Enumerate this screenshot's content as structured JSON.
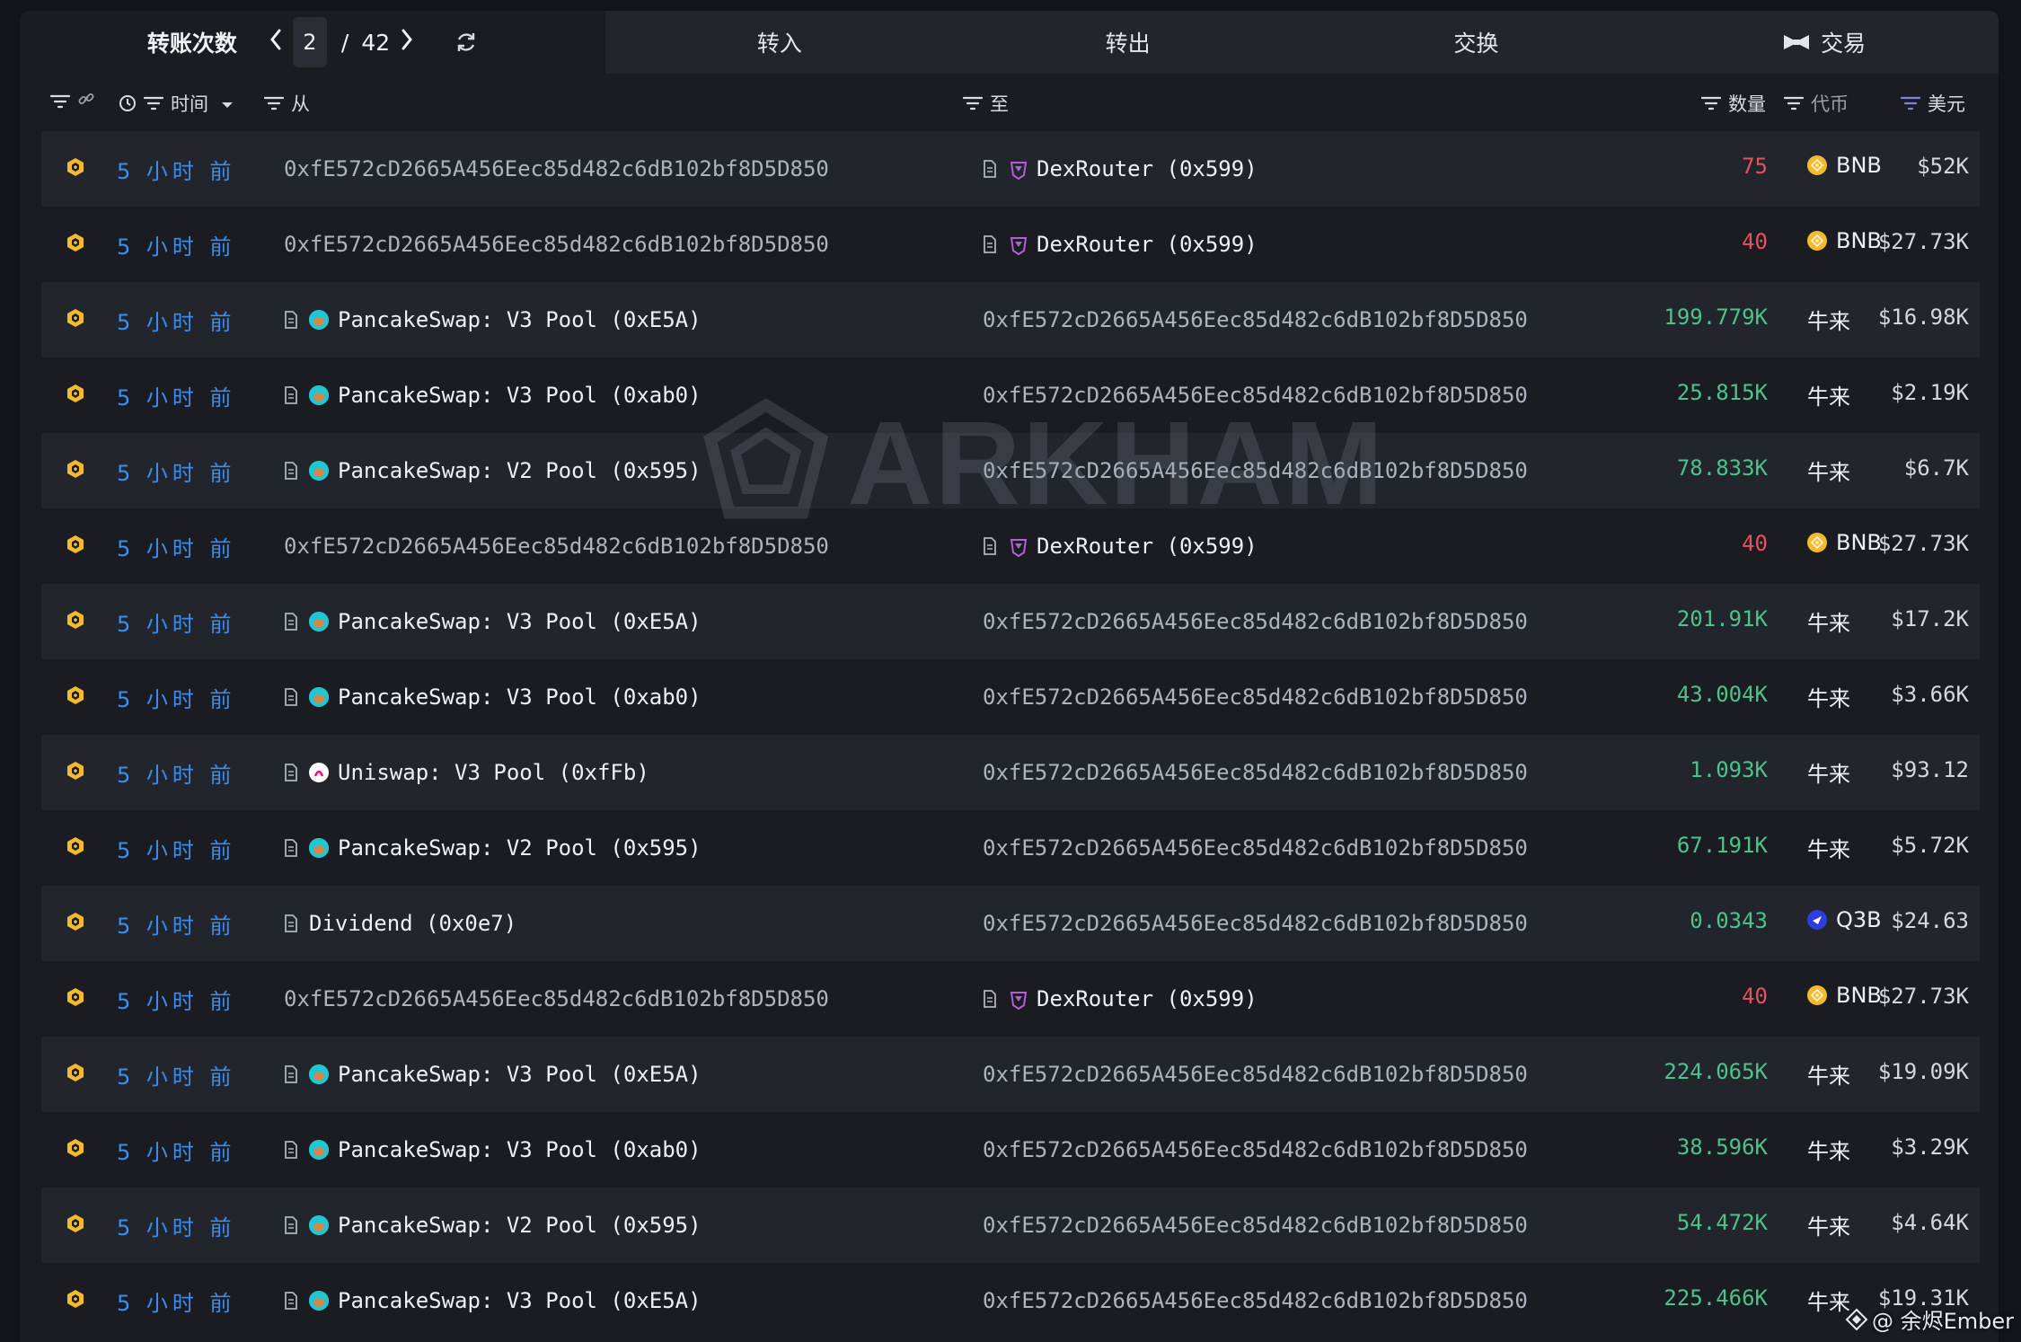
{
  "tabs": {
    "main_label": "转账次数",
    "page_current": "2",
    "page_sep": "/",
    "page_total": "42",
    "transfers_in": "转入",
    "transfers_out": "转出",
    "swaps": "交换",
    "trades": "交易"
  },
  "columns": {
    "time": "时间",
    "from": "从",
    "to": "至",
    "amount": "数量",
    "token": "代币",
    "usd": "美元"
  },
  "rows": [
    {
      "time": "5 小时 前",
      "from": "0xfE572cD2665A456Eec85d482c6dB102bf8D5D850",
      "from_entity": false,
      "from_icon": "",
      "to": "DexRouter (0x599)",
      "to_entity": true,
      "to_icon": "dexrouter-icon",
      "amount": "75",
      "dir": "neg",
      "token": "BNB",
      "token_icon": "bnb-icon",
      "usd": "$52K"
    },
    {
      "time": "5 小时 前",
      "from": "0xfE572cD2665A456Eec85d482c6dB102bf8D5D850",
      "from_entity": false,
      "from_icon": "",
      "to": "DexRouter (0x599)",
      "to_entity": true,
      "to_icon": "dexrouter-icon",
      "amount": "40",
      "dir": "neg",
      "token": "BNB",
      "token_icon": "bnb-icon",
      "usd": "$27.73K"
    },
    {
      "time": "5 小时 前",
      "from": "PancakeSwap: V3 Pool (0xE5A)",
      "from_entity": true,
      "from_icon": "pancakeswap-icon",
      "to": "0xfE572cD2665A456Eec85d482c6dB102bf8D5D850",
      "to_entity": false,
      "to_icon": "",
      "amount": "199.779K",
      "dir": "pos",
      "token": "牛来",
      "token_icon": "",
      "usd": "$16.98K"
    },
    {
      "time": "5 小时 前",
      "from": "PancakeSwap: V3 Pool (0xab0)",
      "from_entity": true,
      "from_icon": "pancakeswap-icon",
      "to": "0xfE572cD2665A456Eec85d482c6dB102bf8D5D850",
      "to_entity": false,
      "to_icon": "",
      "amount": "25.815K",
      "dir": "pos",
      "token": "牛来",
      "token_icon": "",
      "usd": "$2.19K"
    },
    {
      "time": "5 小时 前",
      "from": "PancakeSwap: V2 Pool (0x595)",
      "from_entity": true,
      "from_icon": "pancakeswap-icon",
      "to": "0xfE572cD2665A456Eec85d482c6dB102bf8D5D850",
      "to_entity": false,
      "to_icon": "",
      "amount": "78.833K",
      "dir": "pos",
      "token": "牛来",
      "token_icon": "",
      "usd": "$6.7K"
    },
    {
      "time": "5 小时 前",
      "from": "0xfE572cD2665A456Eec85d482c6dB102bf8D5D850",
      "from_entity": false,
      "from_icon": "",
      "to": "DexRouter (0x599)",
      "to_entity": true,
      "to_icon": "dexrouter-icon",
      "amount": "40",
      "dir": "neg",
      "token": "BNB",
      "token_icon": "bnb-icon",
      "usd": "$27.73K"
    },
    {
      "time": "5 小时 前",
      "from": "PancakeSwap: V3 Pool (0xE5A)",
      "from_entity": true,
      "from_icon": "pancakeswap-icon",
      "to": "0xfE572cD2665A456Eec85d482c6dB102bf8D5D850",
      "to_entity": false,
      "to_icon": "",
      "amount": "201.91K",
      "dir": "pos",
      "token": "牛来",
      "token_icon": "",
      "usd": "$17.2K"
    },
    {
      "time": "5 小时 前",
      "from": "PancakeSwap: V3 Pool (0xab0)",
      "from_entity": true,
      "from_icon": "pancakeswap-icon",
      "to": "0xfE572cD2665A456Eec85d482c6dB102bf8D5D850",
      "to_entity": false,
      "to_icon": "",
      "amount": "43.004K",
      "dir": "pos",
      "token": "牛来",
      "token_icon": "",
      "usd": "$3.66K"
    },
    {
      "time": "5 小时 前",
      "from": "Uniswap: V3 Pool (0xfFb)",
      "from_entity": true,
      "from_icon": "uniswap-icon",
      "to": "0xfE572cD2665A456Eec85d482c6dB102bf8D5D850",
      "to_entity": false,
      "to_icon": "",
      "amount": "1.093K",
      "dir": "pos",
      "token": "牛来",
      "token_icon": "",
      "usd": "$93.12"
    },
    {
      "time": "5 小时 前",
      "from": "PancakeSwap: V2 Pool (0x595)",
      "from_entity": true,
      "from_icon": "pancakeswap-icon",
      "to": "0xfE572cD2665A456Eec85d482c6dB102bf8D5D850",
      "to_entity": false,
      "to_icon": "",
      "amount": "67.191K",
      "dir": "pos",
      "token": "牛来",
      "token_icon": "",
      "usd": "$5.72K"
    },
    {
      "time": "5 小时 前",
      "from": "Dividend (0x0e7)",
      "from_entity": true,
      "from_icon": "",
      "to": "0xfE572cD2665A456Eec85d482c6dB102bf8D5D850",
      "to_entity": false,
      "to_icon": "",
      "amount": "0.0343",
      "dir": "pos",
      "token": "Q3B",
      "token_icon": "q3b-icon",
      "usd": "$24.63"
    },
    {
      "time": "5 小时 前",
      "from": "0xfE572cD2665A456Eec85d482c6dB102bf8D5D850",
      "from_entity": false,
      "from_icon": "",
      "to": "DexRouter (0x599)",
      "to_entity": true,
      "to_icon": "dexrouter-icon",
      "amount": "40",
      "dir": "neg",
      "token": "BNB",
      "token_icon": "bnb-icon",
      "usd": "$27.73K"
    },
    {
      "time": "5 小时 前",
      "from": "PancakeSwap: V3 Pool (0xE5A)",
      "from_entity": true,
      "from_icon": "pancakeswap-icon",
      "to": "0xfE572cD2665A456Eec85d482c6dB102bf8D5D850",
      "to_entity": false,
      "to_icon": "",
      "amount": "224.065K",
      "dir": "pos",
      "token": "牛来",
      "token_icon": "",
      "usd": "$19.09K"
    },
    {
      "time": "5 小时 前",
      "from": "PancakeSwap: V3 Pool (0xab0)",
      "from_entity": true,
      "from_icon": "pancakeswap-icon",
      "to": "0xfE572cD2665A456Eec85d482c6dB102bf8D5D850",
      "to_entity": false,
      "to_icon": "",
      "amount": "38.596K",
      "dir": "pos",
      "token": "牛来",
      "token_icon": "",
      "usd": "$3.29K"
    },
    {
      "time": "5 小时 前",
      "from": "PancakeSwap: V2 Pool (0x595)",
      "from_entity": true,
      "from_icon": "pancakeswap-icon",
      "to": "0xfE572cD2665A456Eec85d482c6dB102bf8D5D850",
      "to_entity": false,
      "to_icon": "",
      "amount": "54.472K",
      "dir": "pos",
      "token": "牛来",
      "token_icon": "",
      "usd": "$4.64K"
    },
    {
      "time": "5 小时 前",
      "from": "PancakeSwap: V3 Pool (0xE5A)",
      "from_entity": true,
      "from_icon": "pancakeswap-icon",
      "to": "0xfE572cD2665A456Eec85d482c6dB102bf8D5D850",
      "to_entity": false,
      "to_icon": "",
      "amount": "225.466K",
      "dir": "pos",
      "token": "牛来",
      "token_icon": "",
      "usd": "$19.31K"
    }
  ],
  "watermark": "ARKHAM",
  "credit": "@ 余烬Ember",
  "colors": {
    "time_link": "#3b8ef0",
    "positive": "#4cc38a",
    "negative": "#e2545e",
    "bnb": "#f3ba2f",
    "pancakeswap": "#1fc7d4",
    "uniswap": "#ff007a",
    "dexrouter": "#b25fd6",
    "q3b": "#2d3ee0"
  }
}
